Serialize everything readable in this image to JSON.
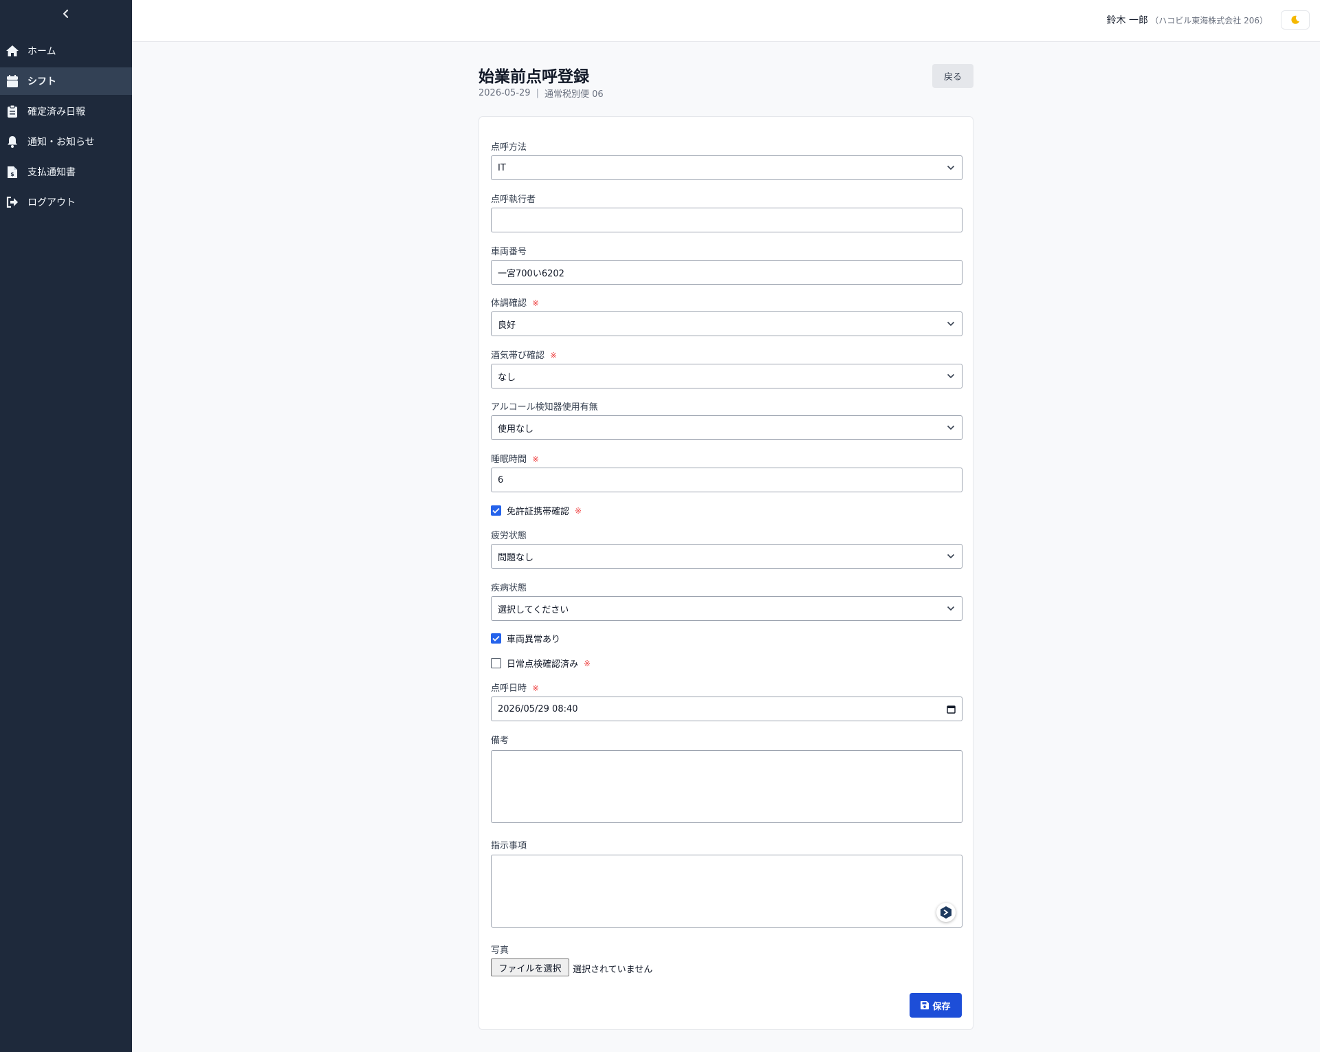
{
  "sidebar": {
    "collapse_icon": "chevron-left-icon",
    "items": [
      {
        "label": "ホーム",
        "icon": "home-icon"
      },
      {
        "label": "シフト",
        "icon": "calendar-icon",
        "active": true
      },
      {
        "label": "確定済み日報",
        "icon": "clipboard-icon"
      },
      {
        "label": "通知・お知らせ",
        "icon": "bell-icon"
      },
      {
        "label": "支払通知書",
        "icon": "invoice-icon"
      },
      {
        "label": "ログアウト",
        "icon": "logout-icon"
      }
    ]
  },
  "header": {
    "user_name": "鈴木 一郎",
    "user_company": "（ハコビル東海株式会社 206）",
    "theme_icon": "moon-icon"
  },
  "page": {
    "title": "始業前点呼登録",
    "date": "2026-05-29",
    "separator": "|",
    "route": "通常税別便 06",
    "back_label": "戻る"
  },
  "form": {
    "required_mark": "※",
    "roll_call_method": {
      "label": "点呼方法",
      "value": "IT"
    },
    "executor": {
      "label": "点呼執行者",
      "value": ""
    },
    "vehicle_number": {
      "label": "車両番号",
      "value": "一宮700い6202"
    },
    "health_check": {
      "label": "体調確認",
      "value": "良好",
      "required": true
    },
    "alcohol_check": {
      "label": "酒気帯び確認",
      "value": "なし",
      "required": true
    },
    "alcohol_detector": {
      "label": "アルコール検知器使用有無",
      "value": "使用なし"
    },
    "sleep_hours": {
      "label": "睡眠時間",
      "value": "6",
      "required": true
    },
    "license_check": {
      "label": "免許証携帯確認",
      "checked": true,
      "required": true
    },
    "fatigue": {
      "label": "疲労状態",
      "value": "問題なし"
    },
    "illness": {
      "label": "疾病状態",
      "value": "選択してください"
    },
    "vehicle_abnormal": {
      "label": "車両異常あり",
      "checked": true
    },
    "daily_inspection": {
      "label": "日常点検確認済み",
      "checked": false,
      "required": true
    },
    "roll_call_datetime": {
      "label": "点呼日時",
      "value": "2026/05/29 08:40",
      "required": true
    },
    "remarks": {
      "label": "備考",
      "value": ""
    },
    "instructions": {
      "label": "指示事項",
      "value": ""
    },
    "photo": {
      "label": "写真",
      "button_label": "ファイルを選択",
      "status": "選択されていません"
    },
    "save_label": "保存"
  },
  "colors": {
    "sidebar_bg": "#1e293b",
    "sidebar_active": "#334155",
    "primary": "#1d4ed8",
    "required": "#ef4444",
    "checkbox": "#2563eb"
  }
}
